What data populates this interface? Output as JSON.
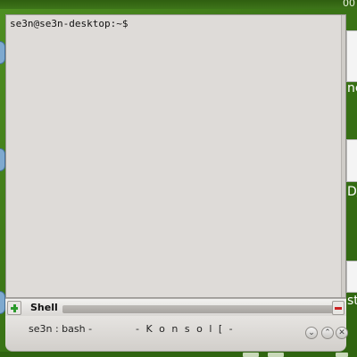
{
  "clock": {
    "text": "00"
  },
  "terminal": {
    "prompt": "se3n@se3n-desktop:~$"
  },
  "tabbar": {
    "tab_label": "Shell"
  },
  "titlebar": {
    "session": "se3n : bash -",
    "app_title": "- K o n s o l [ -"
  },
  "window_buttons": {
    "minimize": "⌄",
    "maximize": "⌃",
    "close": "✕"
  },
  "background_text": {
    "right_1": "nc",
    "right_2": "D/",
    "right_3": "st"
  },
  "colors": {
    "desktop": "#3b7516",
    "terminal_bg": "#dedbd8",
    "new_tab_icon": "#2c9a2c",
    "close_tab_icon": "#cc2222"
  },
  "icons": {
    "new_tab": "plus-icon",
    "close_tab": "minus-icon"
  }
}
